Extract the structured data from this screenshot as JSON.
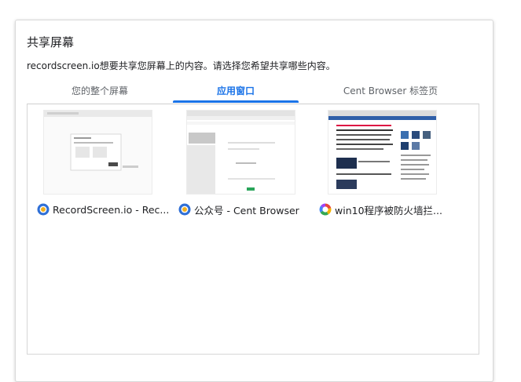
{
  "dialog": {
    "title": "共享屏幕",
    "description": "recordscreen.io想要共享您屏幕上的内容。请选择您希望共享哪些内容。"
  },
  "tabs": [
    {
      "label": "您的整个屏幕",
      "active": false
    },
    {
      "label": "应用窗口",
      "active": true
    },
    {
      "label": "Cent Browser 标签页",
      "active": false
    }
  ],
  "windows": [
    {
      "title": "RecordScreen.io - Rec...",
      "icon": "cent-browser-icon"
    },
    {
      "title": "公众号 - Cent Browser",
      "icon": "cent-browser-icon"
    },
    {
      "title": "win10程序被防火墙拦...",
      "icon": "colorful-browser-icon"
    }
  ],
  "colors": {
    "accent": "#1a73e8",
    "border": "#d6d6d6"
  }
}
